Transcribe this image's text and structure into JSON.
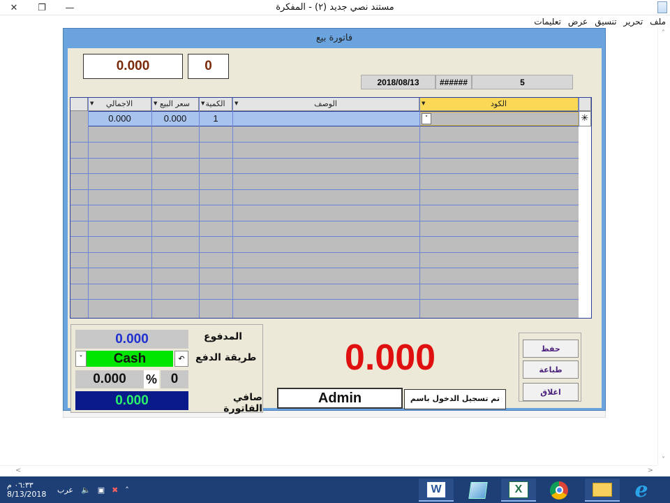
{
  "window": {
    "title": "مستند نصي جديد (٢) - المفكرة"
  },
  "menu": [
    "ملف",
    "تحرير",
    "تنسيق",
    "عرض",
    "تعليمات"
  ],
  "invoice": {
    "title": "فاتورة بيع",
    "total_box": "0.000",
    "count_box": "0",
    "date": "2018/08/13",
    "hash": "######",
    "number": "5",
    "columns": [
      "الاجمالي",
      "سعر البيع",
      "الكمية",
      "الوصف",
      "الكود"
    ],
    "rows": [
      {
        "total": "0.000",
        "price": "0.000",
        "qty": "1",
        "desc": "",
        "code": ""
      }
    ],
    "new_row_marker": "✳",
    "paid_label": "المدفوع",
    "paid_value": "0.000",
    "payment_label": "طريقة الدفع",
    "payment_value": "Cash",
    "discount_value": "0.000",
    "percent_sign": "%",
    "percent_value": "0",
    "net_label": "صافي الفاتورة",
    "net_value": "0.000",
    "big_total": "0.000",
    "user_value": "Admin",
    "logged_label": "تم تسجيل الدخول باسم",
    "buttons": {
      "save": "حفظ",
      "print": "طباعة",
      "close": "اغلاق"
    }
  },
  "taskbar": {
    "apps": [
      "word-icon",
      "notepad-icon",
      "excel-icon",
      "chrome-icon",
      "explorer-icon",
      "ie-icon"
    ],
    "time": "٠٦:٣٣ م",
    "date": "8/13/2018",
    "lang": "عرب"
  },
  "colors": {
    "accent": "#6aa3de",
    "grid_header_selected": "#fbd957",
    "big_total": "#e01010",
    "cash_bg": "#00e600",
    "net_bg": "#0a1a8a"
  }
}
